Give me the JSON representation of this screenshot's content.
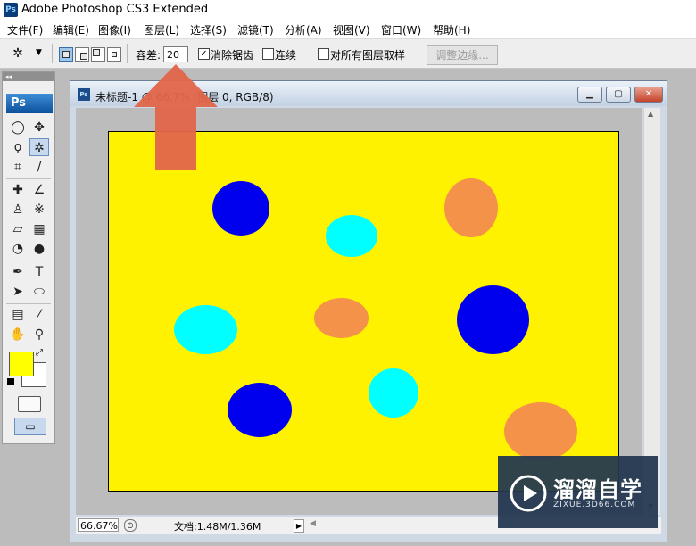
{
  "app": {
    "icon_text": "Ps",
    "title": "Adobe Photoshop CS3 Extended"
  },
  "menu": {
    "items": [
      "文件(F)",
      "编辑(E)",
      "图像(I)",
      "图层(L)",
      "选择(S)",
      "滤镜(T)",
      "分析(A)",
      "视图(V)",
      "窗口(W)",
      "帮助(H)"
    ]
  },
  "options": {
    "tool_icon": "magic-wand-icon",
    "selection_modes": [
      "new-selection",
      "add-to-selection",
      "subtract-from-selection",
      "intersect-selection"
    ],
    "active_mode": "new-selection",
    "tolerance_label": "容差:",
    "tolerance_value": "20",
    "anti_alias_label": "消除锯齿",
    "anti_alias_checked": true,
    "contiguous_label": "连续",
    "contiguous_checked": false,
    "sample_all_label": "对所有图层取样",
    "sample_all_checked": false,
    "refine_edge_label": "调整边缘..."
  },
  "toolbox": {
    "logo": "Ps",
    "active_tool": "magic-wand-tool",
    "foreground_color": "#ffff00",
    "background_color": "#ffffff"
  },
  "document": {
    "icon_text": "Ps",
    "title": "未标题-1 @ 66.7% (图层 0, RGB/8)",
    "zoom": "66.67%",
    "doc_info": "文档:1.48M/1.36M"
  },
  "canvas": {
    "background": "#fff200",
    "shapes": [
      {
        "color": "#0000ee"
      },
      {
        "color": "#00ffff"
      },
      {
        "color": "#f4924a"
      },
      {
        "color": "#00ffff"
      },
      {
        "color": "#f4924a"
      },
      {
        "color": "#0000ee"
      },
      {
        "color": "#0000ee"
      },
      {
        "color": "#00ffff"
      },
      {
        "color": "#f4924a"
      }
    ]
  },
  "annotation": {
    "type": "arrow-up",
    "color": "#e0654a"
  },
  "watermark": {
    "name": "溜溜自学",
    "url": "ZIXUE.3D66.COM"
  }
}
